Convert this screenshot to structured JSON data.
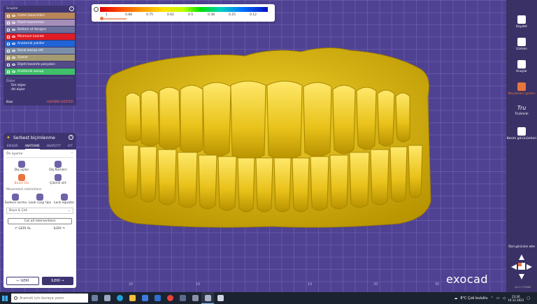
{
  "legend": {
    "ticks": [
      "1",
      "0.88",
      "0.75",
      "0.62",
      "0.5",
      "0.38",
      "0.25",
      "0.12"
    ]
  },
  "groups_panel": {
    "title": "Gruplar",
    "items": [
      {
        "label": "Ceme tasarımları",
        "color": "#b8865a"
      },
      {
        "label": "Dişeti tasarımları",
        "color": "#a58fb8"
      },
      {
        "label": "Bottom of designs",
        "color": "#6e6e9a"
      },
      {
        "label": "Minimum kalınlık",
        "color": "#e01b24"
      },
      {
        "label": "Anatomik şekiller",
        "color": "#1f63d6"
      },
      {
        "label": "Sanal wasup ekt",
        "color": "#7d8fa8"
      },
      {
        "label": "Sizeler",
        "color": "#a49a72"
      },
      {
        "label": "Dişeti tasarımı parçaları",
        "color": "#544a86"
      },
      {
        "label": "Anatomik wasup",
        "color": "#3fbf6a"
      }
    ],
    "teeth_section": "Dişler",
    "teeth": [
      "Üst dişler",
      "Alt dişler"
    ],
    "footer_left": "Bazı",
    "footer_right": "HEPSİNİ GÖSTER"
  },
  "tool_panel": {
    "title": "Serbest biçimlenme",
    "tabs": [
      "BIREBIR",
      "ANATOMIK",
      "ANAPSYTT",
      "AYT"
    ],
    "active_tab": 1,
    "presets_label": "Ön ayarlar",
    "presets": [
      {
        "label": "Diş uçları",
        "active": false
      },
      {
        "label": "Diş Kümleri",
        "active": false
      },
      {
        "label": "Bulus Dis",
        "active": true
      },
      {
        "label": "Çikimli sirt",
        "active": false
      }
    ],
    "movement_label": "Movement restrictions",
    "movements": [
      "Sadece ısırma",
      "Look cusp tips",
      "Lock equator"
    ],
    "dropdown_label": "Boya & Çek",
    "cut_button": "Cut all intersections",
    "undo": "GERİ AL",
    "redo": "İLERİ",
    "back": "GERİ",
    "next": "İLERİ"
  },
  "sidebar": {
    "items": [
      {
        "label": "Kaydet",
        "active": false,
        "icon": "save-icon"
      },
      {
        "label": "Uzman",
        "active": false,
        "icon": "graduation-cap-icon"
      },
      {
        "label": "Araçlar",
        "active": false,
        "icon": "tools-icon"
      },
      {
        "label": "Mesafeleri göster",
        "active": true,
        "icon": "tooth-icon"
      },
      {
        "label": "TruSmile",
        "active": false,
        "icon": "trusmile-icon"
      },
      {
        "label": "Kesim görünümleri",
        "active": false,
        "icon": "cut-view-icon"
      }
    ],
    "tru_text": "Tru",
    "free_view": "Özel görünüm ekle",
    "version": "v3.0-7734/64"
  },
  "brand": "exocad",
  "axis_labels": [
    "20",
    "10",
    "10",
    "20",
    "30"
  ],
  "taskbar": {
    "search_placeholder": "Aramak için buraya yazın",
    "weather": "8°C  Çok bulutlu",
    "time": "23:26",
    "date": "14.12.2022"
  }
}
